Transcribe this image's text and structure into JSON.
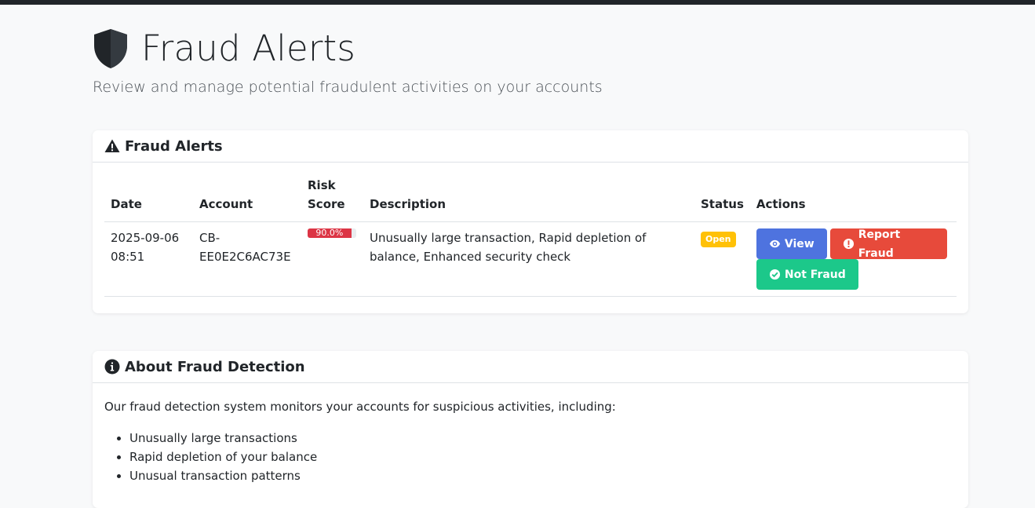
{
  "page": {
    "title": "Fraud Alerts",
    "subtitle": "Review and manage potential fraudulent activities on your accounts"
  },
  "alerts_card": {
    "header": "Fraud Alerts",
    "columns": {
      "date": "Date",
      "account": "Account",
      "risk_line1": "Risk",
      "risk_line2": "Score",
      "description": "Description",
      "status": "Status",
      "actions": "Actions"
    },
    "rows": [
      {
        "date_line1": "2025-09-06",
        "date_line2": "08:51",
        "account_line1": "CB-",
        "account_line2": "EE0E2C6AC73E",
        "risk_label": "90.0%",
        "risk_fraction": 0.9,
        "description": "Unusually large transaction, Rapid depletion of balance, Enhanced security check",
        "status": "Open",
        "view_label": "View",
        "report_label": "Report Fraud",
        "not_fraud_label": "Not Fraud"
      }
    ]
  },
  "about_card": {
    "header": "About Fraud Detection",
    "intro": "Our fraud detection system monitors your accounts for suspicious activities, including:",
    "items": [
      "Unusually large transactions",
      "Rapid depletion of your balance",
      "Unusual transaction patterns"
    ]
  },
  "colors": {
    "danger": "#dc3545",
    "warning": "#ffc107",
    "primary": "#4e73df",
    "report": "#e74a3b",
    "success": "#1cc88a"
  }
}
